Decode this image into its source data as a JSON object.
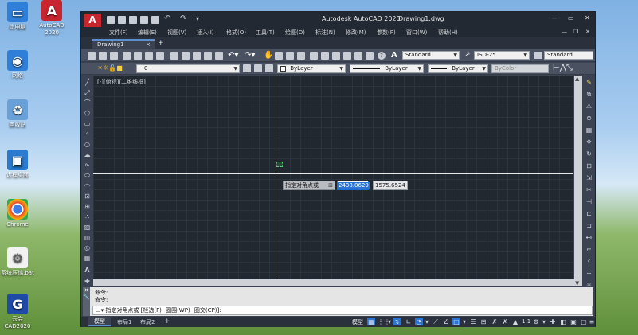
{
  "desktop": {
    "icons": [
      {
        "label": "此电脑",
        "glyph": "▭",
        "color": "#2f7fd8"
      },
      {
        "label": "AutoCAD 2020",
        "glyph": "A",
        "color": "#c9252f"
      },
      {
        "label": "网络",
        "glyph": "◉",
        "color": "#2f7fd8"
      },
      {
        "label": "回收站",
        "glyph": "♻",
        "color": "#6aa0d8"
      },
      {
        "label": "远程桌面",
        "glyph": "▣",
        "color": "#2a7ad0"
      },
      {
        "label": "Chrome",
        "glyph": "●",
        "color": "#2a8f3c"
      },
      {
        "label": "系统压缩.bat",
        "glyph": "⚙",
        "color": "#5a5a5a"
      },
      {
        "label": "云会 CAD2020",
        "glyph": "G",
        "color": "#1f4aa8"
      }
    ]
  },
  "window": {
    "app_logo": "A",
    "title": "Autodesk AutoCAD 2020",
    "filename": "Drawing1.dwg",
    "controls": {
      "minimize": "—",
      "maximize": "▭",
      "close": "✕"
    },
    "menu": [
      "文件(F)",
      "编辑(E)",
      "视图(V)",
      "插入(I)",
      "格式(O)",
      "工具(T)",
      "绘图(D)",
      "标注(N)",
      "修改(M)",
      "参数(P)",
      "窗口(W)",
      "帮助(H)"
    ],
    "doc_controls": {
      "minimize": "—",
      "restore": "❐",
      "close": "✕"
    }
  },
  "tabs": {
    "active": "Drawing1",
    "close": "×",
    "add": "+"
  },
  "toolbar1": {
    "text_style": "Standard",
    "dim_style": "ISO-25",
    "table_style": "Standard"
  },
  "toolbar2": {
    "layer": "0",
    "color": "ByLayer",
    "linetype": "ByLayer",
    "lineweight": "ByLayer",
    "plotstyle": "ByColor"
  },
  "viewport": {
    "label": "[-][俯视][二维线框]",
    "prompt_label": "指定对角点或",
    "prompt_key": "⊞",
    "coord_x": "2438.0629",
    "coord_y": "1575.6524"
  },
  "command": {
    "history": [
      "命令:",
      "命令:"
    ],
    "current": "指定对角点或",
    "options": [
      "[栏选(F)",
      "圈围(WP)",
      "圈交(CP)]:"
    ]
  },
  "status": {
    "tabs": [
      "模型",
      "布局1",
      "布局2"
    ],
    "add": "+",
    "model_label": "模型",
    "scale": "1:1"
  }
}
